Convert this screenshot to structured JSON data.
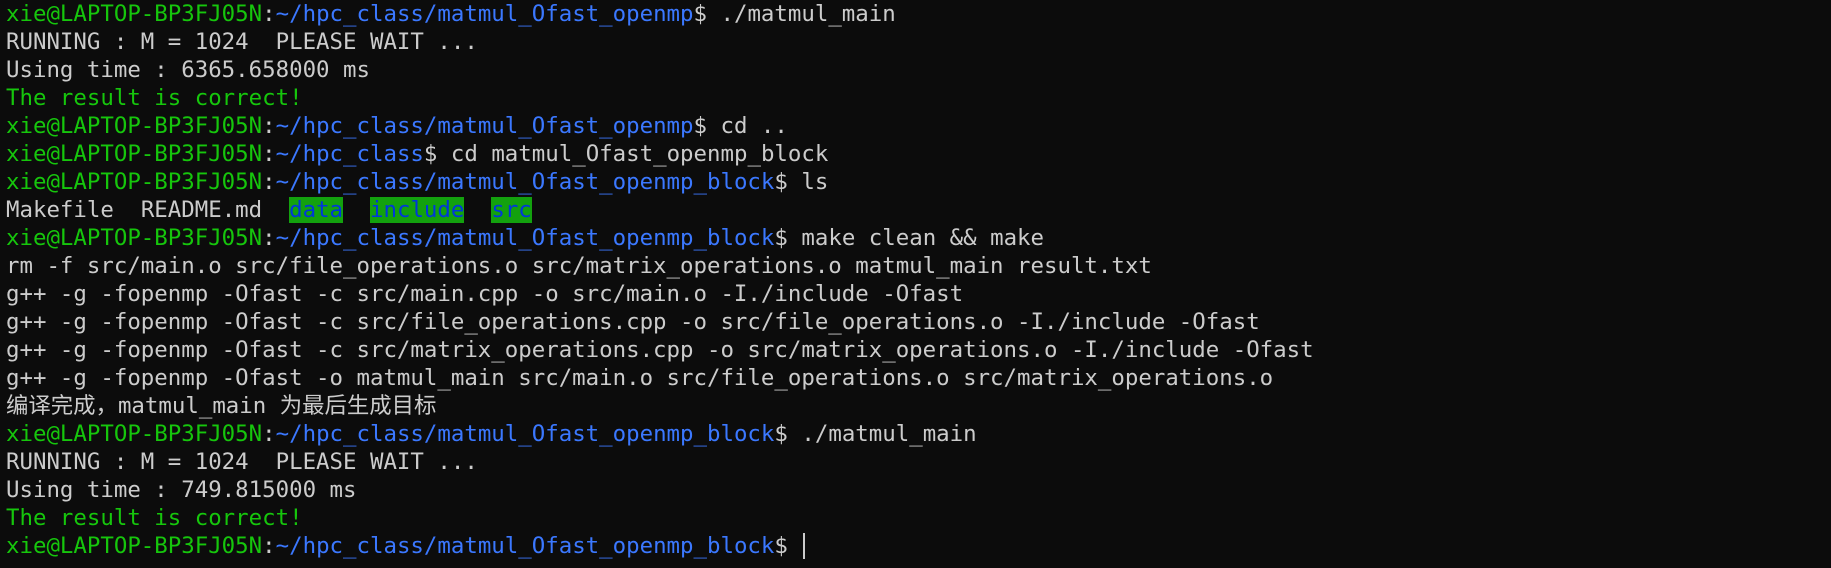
{
  "terminal": {
    "prompt": {
      "user": "xie@LAPTOP-BP3FJ05N",
      "sep": ":",
      "dollar": "$ "
    },
    "lines": {
      "l0": {
        "path": "~/hpc_class/matmul_Ofast_openmp",
        "cmd": "./matmul_main"
      },
      "l1": "RUNNING : M = 1024  PLEASE WAIT ...",
      "l2": "Using time : 6365.658000 ms",
      "l3": "The result is correct!",
      "l4": {
        "path": "~/hpc_class/matmul_Ofast_openmp",
        "cmd": "cd .."
      },
      "l5": {
        "path": "~/hpc_class",
        "cmd": "cd matmul_Ofast_openmp_block"
      },
      "l6": {
        "path": "~/hpc_class/matmul_Ofast_openmp_block",
        "cmd": "ls"
      },
      "l7": {
        "file1": "Makefile",
        "file2": "README.md",
        "dir1": "data",
        "dir2": "include",
        "dir3": "src"
      },
      "l8": {
        "path": "~/hpc_class/matmul_Ofast_openmp_block",
        "cmd": "make clean && make"
      },
      "l9": "rm -f src/main.o src/file_operations.o src/matrix_operations.o matmul_main result.txt",
      "l10": "g++ -g -fopenmp -Ofast -c src/main.cpp -o src/main.o -I./include -Ofast",
      "l11": "g++ -g -fopenmp -Ofast -c src/file_operations.cpp -o src/file_operations.o -I./include -Ofast",
      "l12": "g++ -g -fopenmp -Ofast -c src/matrix_operations.cpp -o src/matrix_operations.o -I./include -Ofast",
      "l13": "g++ -g -fopenmp -Ofast -o matmul_main src/main.o src/file_operations.o src/matrix_operations.o",
      "l14": "编译完成，matmul_main 为最后生成目标",
      "l15": {
        "path": "~/hpc_class/matmul_Ofast_openmp_block",
        "cmd": "./matmul_main"
      },
      "l16": "RUNNING : M = 1024  PLEASE WAIT ...",
      "l17": "Using time : 749.815000 ms",
      "l18": "The result is correct!",
      "l19": {
        "path": "~/hpc_class/matmul_Ofast_openmp_block",
        "cmd": ""
      }
    }
  },
  "colors": {
    "background": "#0c0c0c",
    "foreground": "#cccccc",
    "user_green": "#16c60c",
    "path_blue": "#3b78ff",
    "dir_bg": "#13a10e",
    "dir_fg": "#0037da"
  }
}
